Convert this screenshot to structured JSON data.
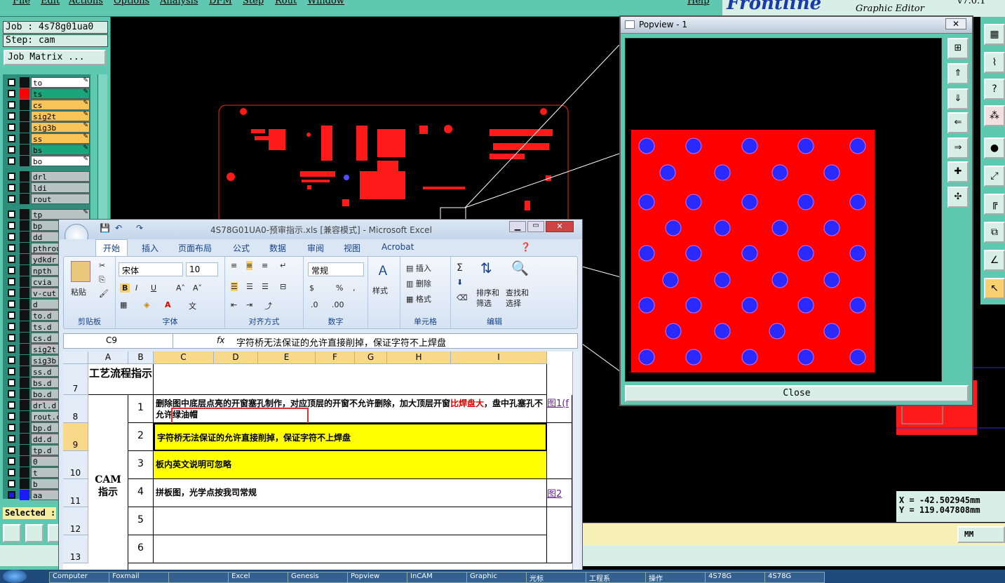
{
  "menubar": {
    "items": [
      "File",
      "Edit",
      "Actions",
      "Options",
      "Analysis",
      "DFM",
      "Step",
      "Rout",
      "Window"
    ],
    "help": "Help"
  },
  "logo": {
    "brand": "Frontline",
    "subtitle": "Graphic Editor",
    "version": "v7.0.1"
  },
  "job": {
    "job_label": "Job : 4s78g01ua0",
    "step_label": "Step: cam",
    "matrix_button": "Job Matrix ..."
  },
  "layers": [
    {
      "name": "to",
      "color": "#ffffff",
      "mark": true
    },
    {
      "name": "ts",
      "color": "#1aa57a",
      "mark": true,
      "active": true
    },
    {
      "name": "cs",
      "color": "#f8c458",
      "mark": true
    },
    {
      "name": "sig2t",
      "color": "#f8c458",
      "mark": true
    },
    {
      "name": "sig3b",
      "color": "#f8c458",
      "mark": true
    },
    {
      "name": "ss",
      "color": "#f8c458",
      "mark": true
    },
    {
      "name": "bs",
      "color": "#1aa57a",
      "mark": true
    },
    {
      "name": "bo",
      "color": "#ffffff",
      "mark": true
    },
    {
      "name": "drl",
      "color": "#b8c4c4",
      "mark": false
    },
    {
      "name": "ldi",
      "color": "#b8c4c4",
      "mark": false
    },
    {
      "name": "rout",
      "color": "#b8c4c4",
      "mark": false
    },
    {
      "name": "tp",
      "color": "#b8c4c4",
      "mark": true
    },
    {
      "name": "bp",
      "color": "#b8c4c4",
      "mark": true
    },
    {
      "name": "dd",
      "color": "#b8c4c4",
      "mark": false
    },
    {
      "name": "pthrou",
      "color": "#b8c4c4",
      "mark": false
    },
    {
      "name": "ydkdr",
      "color": "#b8c4c4",
      "mark": false
    },
    {
      "name": "npth",
      "color": "#b8c4c4",
      "mark": false
    },
    {
      "name": "cvia",
      "color": "#b8c4c4",
      "mark": false
    },
    {
      "name": "v-cut",
      "color": "#b8c4c4",
      "mark": false
    },
    {
      "name": "d",
      "color": "#b8c4c4",
      "mark": false
    },
    {
      "name": "to.d",
      "color": "#b8c4c4",
      "mark": false
    },
    {
      "name": "ts.d",
      "color": "#b8c4c4",
      "mark": false
    },
    {
      "name": "cs.d",
      "color": "#b8c4c4",
      "mark": false
    },
    {
      "name": "sig2t",
      "color": "#b8c4c4",
      "mark": false
    },
    {
      "name": "sig3b",
      "color": "#b8c4c4",
      "mark": false
    },
    {
      "name": "ss.d",
      "color": "#b8c4c4",
      "mark": false
    },
    {
      "name": "bs.d",
      "color": "#b8c4c4",
      "mark": false
    },
    {
      "name": "bo.d",
      "color": "#b8c4c4",
      "mark": false
    },
    {
      "name": "drl.d",
      "color": "#b8c4c4",
      "mark": false
    },
    {
      "name": "rout.c",
      "color": "#b8c4c4",
      "mark": false
    },
    {
      "name": "bp.d",
      "color": "#b8c4c4",
      "mark": false
    },
    {
      "name": "dd.d",
      "color": "#b8c4c4",
      "mark": false
    },
    {
      "name": "tp.d",
      "color": "#b8c4c4",
      "mark": false
    },
    {
      "name": "0",
      "color": "#b8c4c4",
      "mark": false
    },
    {
      "name": "t",
      "color": "#b8c4c4",
      "mark": false
    },
    {
      "name": "b",
      "color": "#b8c4c4",
      "mark": false
    },
    {
      "name": "aa",
      "color": "#b8c4c4",
      "mark": false,
      "blue": true
    }
  ],
  "status": {
    "selected": "Selected :",
    "units": "MM"
  },
  "coords": {
    "x": "X = -42.502945mm",
    "y": "Y = 119.047808mm"
  },
  "popview": {
    "title": "Popview - 1",
    "close": "Close"
  },
  "excel": {
    "title": "4S78G01UA0-预审指示.xls  [兼容模式] - Microsoft Excel",
    "tabs": [
      "开始",
      "插入",
      "页面布局",
      "公式",
      "数据",
      "审阅",
      "视图",
      "Acrobat"
    ],
    "ribbon": {
      "paste": "粘贴",
      "clipboard": "剪贴板",
      "font_name": "宋体",
      "font_size": "10",
      "font": "字体",
      "align": "对齐方式",
      "num_format": "常规",
      "number": "数字",
      "styles": "样式",
      "insert": "插入",
      "delete": "删除",
      "format": "格式",
      "cells": "单元格",
      "sort": "排序和\n筛选",
      "find": "查找和\n选择",
      "editing": "编辑"
    },
    "namebox": "C9",
    "fx": "fx",
    "formula": "字符桥无法保证的允许直接削掉，保证字符不上焊盘",
    "columns": [
      "A",
      "B",
      "C",
      "D",
      "E",
      "F",
      "G",
      "H",
      "I"
    ],
    "rows": [
      "7",
      "8",
      "9",
      "10",
      "11",
      "12",
      "13"
    ],
    "cells": {
      "a7": "工艺流程指示",
      "a_cam": "CAM指示",
      "b8": "1",
      "b9": "2",
      "b10": "3",
      "b11": "4",
      "b12": "5",
      "b13": "6",
      "c8a": "删除图中底层点亮的开窗塞孔制作，对应顶层的开窗不允许删除，加大顶层开窗",
      "c8red": "比焊盘大",
      "c8b": "，盘中孔塞孔不允许绿油帽",
      "c9": "字符桥无法保证的允许直接削掉，保证字符不上焊盘",
      "c10": "板内英文说明可忽略",
      "c11": "拼板图，光学点按我司常规",
      "i8": "图1(f",
      "i11": "图2"
    }
  },
  "taskbar": [
    "Computer",
    "Foxmail",
    "",
    "Excel",
    "Genesis",
    "Popview",
    "InCAM",
    "Graphic",
    "光标",
    "工程系",
    "操作",
    "4S78G",
    "4S78G"
  ]
}
